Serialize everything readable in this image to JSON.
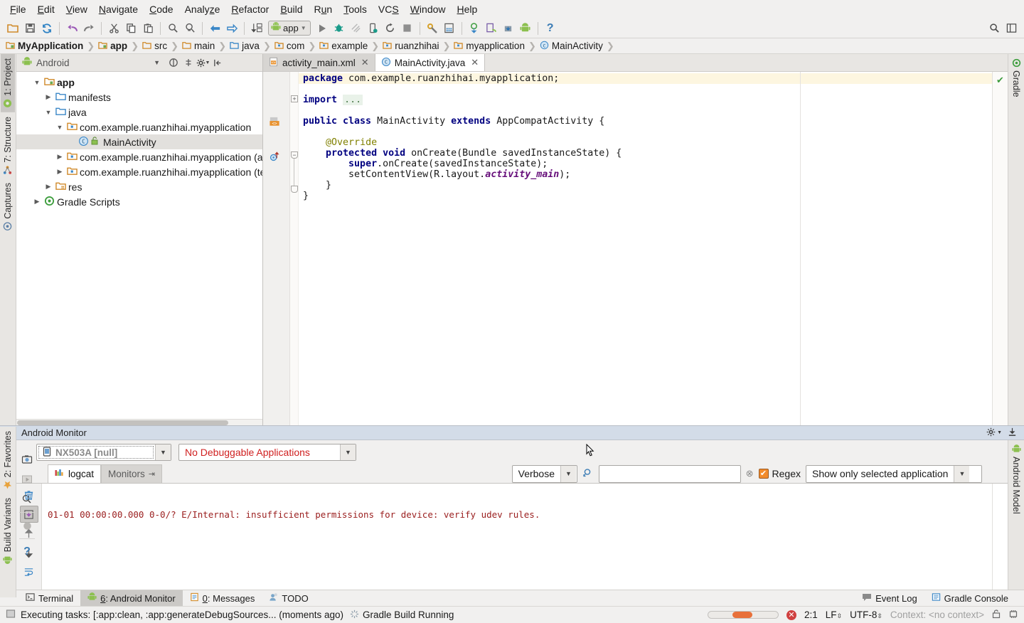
{
  "menu": {
    "items": [
      {
        "label": "File",
        "mnemonic": "F"
      },
      {
        "label": "Edit",
        "mnemonic": "E"
      },
      {
        "label": "View",
        "mnemonic": "V"
      },
      {
        "label": "Navigate",
        "mnemonic": "N"
      },
      {
        "label": "Code",
        "mnemonic": "C"
      },
      {
        "label": "Analyze",
        "mnemonic": "z"
      },
      {
        "label": "Refactor",
        "mnemonic": "R"
      },
      {
        "label": "Build",
        "mnemonic": "B"
      },
      {
        "label": "Run",
        "mnemonic": "u"
      },
      {
        "label": "Tools",
        "mnemonic": "T"
      },
      {
        "label": "VCS",
        "mnemonic": "S"
      },
      {
        "label": "Window",
        "mnemonic": "W"
      },
      {
        "label": "Help",
        "mnemonic": "H"
      }
    ]
  },
  "toolbar": {
    "icons": [
      "open-folder-icon",
      "save-all-icon",
      "sync-icon",
      "undo-icon",
      "redo-icon",
      "cut-icon",
      "copy-icon",
      "paste-icon",
      "find-icon",
      "replace-icon",
      "back-icon",
      "forward-icon",
      "compile-icon"
    ],
    "run_config_label": "app",
    "run_icons": [
      "run-icon",
      "debug-icon",
      "coverage-icon",
      "attach-debugger-icon",
      "rerun-icon",
      "stop-icon",
      "sdk-manager-icon",
      "avd-manager-icon",
      "sync-gradle-icon",
      "device-monitor-icon",
      "sdk-update-icon",
      "android-icon",
      "help-icon"
    ],
    "right_icons": [
      "search-everywhere-icon",
      "layout-icon"
    ]
  },
  "breadcrumb": {
    "items": [
      {
        "label": "MyApplication",
        "icon": "module-icon",
        "bold": true
      },
      {
        "label": "app",
        "icon": "module-icon",
        "bold": true
      },
      {
        "label": "src",
        "icon": "folder-icon",
        "bold": false
      },
      {
        "label": "main",
        "icon": "folder-icon",
        "bold": false
      },
      {
        "label": "java",
        "icon": "source-folder-icon",
        "bold": false
      },
      {
        "label": "com",
        "icon": "package-icon",
        "bold": false
      },
      {
        "label": "example",
        "icon": "package-icon",
        "bold": false
      },
      {
        "label": "ruanzhihai",
        "icon": "package-icon",
        "bold": false
      },
      {
        "label": "myapplication",
        "icon": "package-icon",
        "bold": false
      },
      {
        "label": "MainActivity",
        "icon": "class-icon",
        "bold": false
      }
    ]
  },
  "left_strip": {
    "tabs": [
      {
        "label": "1: Project",
        "icon": "project-icon",
        "active": true
      },
      {
        "label": "7: Structure",
        "icon": "structure-icon",
        "active": false
      },
      {
        "label": "Captures",
        "icon": "captures-icon",
        "active": false
      }
    ],
    "bottom_tabs": [
      {
        "label": "2: Favorites",
        "icon": "star-icon"
      },
      {
        "label": "Build Variants",
        "icon": "android-icon"
      }
    ]
  },
  "right_strip": {
    "tabs": [
      {
        "label": "Gradle",
        "icon": "gradle-icon"
      }
    ],
    "bottom_tabs": [
      {
        "label": "Android Model",
        "icon": "android-icon"
      }
    ]
  },
  "project_panel": {
    "view_selector": "Android",
    "header_icons": [
      "collapse-all-icon",
      "scroll-from-source-icon",
      "settings-icon",
      "hide-icon"
    ],
    "tree": [
      {
        "label": "app",
        "depth": 0,
        "arrow": "down",
        "icon": "module-icon",
        "bold": true,
        "selected": false
      },
      {
        "label": "manifests",
        "depth": 1,
        "arrow": "right",
        "icon": "folder-icon",
        "bold": false,
        "selected": false
      },
      {
        "label": "java",
        "depth": 1,
        "arrow": "down",
        "icon": "source-folder-icon",
        "bold": false,
        "selected": false
      },
      {
        "label": "com.example.ruanzhihai.myapplication",
        "depth": 2,
        "arrow": "down",
        "icon": "package-icon",
        "bold": false,
        "selected": false
      },
      {
        "label": "MainActivity",
        "depth": 3,
        "arrow": "none",
        "icon": "class-icon",
        "bold": false,
        "selected": true
      },
      {
        "label": "com.example.ruanzhihai.myapplication (androidTest)",
        "depth": 2,
        "arrow": "right",
        "icon": "package-icon",
        "bold": false,
        "selected": false
      },
      {
        "label": "com.example.ruanzhihai.myapplication (test)",
        "depth": 2,
        "arrow": "right",
        "icon": "package-icon",
        "bold": false,
        "selected": false
      },
      {
        "label": "res",
        "depth": 1,
        "arrow": "right",
        "icon": "res-folder-icon",
        "bold": false,
        "selected": false
      },
      {
        "label": "Gradle Scripts",
        "depth": 0,
        "arrow": "right",
        "icon": "gradle-icon",
        "bold": false,
        "selected": false
      }
    ]
  },
  "editor": {
    "tabs": [
      {
        "label": "activity_main.xml",
        "icon": "xml-file-icon",
        "active": false
      },
      {
        "label": "MainActivity.java",
        "icon": "class-icon",
        "active": true
      }
    ],
    "code_lines": [
      "package com.example.ruanzhihai.myapplication;",
      "",
      "import ...",
      "",
      "public class MainActivity extends AppCompatActivity {",
      "",
      "    @Override",
      "    protected void onCreate(Bundle savedInstanceState) {",
      "        super.onCreate(savedInstanceState);",
      "        setContentView(R.layout.activity_main);",
      "    }",
      "}"
    ],
    "status_marker": "inspection-ok-icon",
    "gutter_icons": [
      "xml-resource-icon",
      "override-method-icon"
    ]
  },
  "monitor": {
    "title": "Android Monitor",
    "title_icons": [
      "settings-icon",
      "minimize-icon"
    ],
    "device": "NX503A [null]",
    "device_icon": "phone-icon",
    "application": "No Debuggable Applications",
    "application_color": "#d02020",
    "tabs": [
      {
        "label": "logcat",
        "icon": "logcat-icon",
        "active": true
      },
      {
        "label": "Monitors",
        "icon": "monitors-icon",
        "active": false
      }
    ],
    "log_level": "Verbose",
    "search_value": "",
    "search_placeholder": "",
    "regex_label": "Regex",
    "regex_checked": true,
    "scope": "Show only selected application",
    "tool_icons": [
      {
        "name": "clear-logcat-icon",
        "selected": false
      },
      {
        "name": "scroll-to-end-icon",
        "selected": true
      },
      {
        "name": "up-the-stack-icon",
        "selected": false
      },
      {
        "name": "down-the-stack-icon",
        "selected": false
      },
      {
        "name": "soft-wrap-icon",
        "selected": false
      }
    ],
    "log_lines": [
      "01-01 00:00:00.000 0-0/? E/Internal: insufficient permissions for device: verify udev rules."
    ]
  },
  "bottom_tabs": {
    "items": [
      {
        "label": "Terminal",
        "icon": "terminal-icon",
        "active": false,
        "num": ""
      },
      {
        "label": "Android Monitor",
        "icon": "android-icon",
        "active": true,
        "num": "6"
      },
      {
        "label": "Messages",
        "icon": "messages-icon",
        "active": false,
        "num": "0"
      },
      {
        "label": "TODO",
        "icon": "todo-icon",
        "active": false,
        "num": ""
      }
    ],
    "right_items": [
      {
        "label": "Event Log",
        "icon": "event-log-icon"
      },
      {
        "label": "Gradle Console",
        "icon": "gradle-console-icon"
      }
    ]
  },
  "status_bar": {
    "icon": "build-icon",
    "message": "Executing tasks: [:app:clean, :app:generateDebugSources... (moments ago)",
    "build_status": "Gradle Build Running",
    "build_status_icon": "spinner-icon",
    "caret_position": "2:1",
    "line_separator": "LF",
    "encoding": "UTF-8",
    "context": "Context: <no context>",
    "right_icons": [
      "lock-icon",
      "memory-icon"
    ]
  }
}
